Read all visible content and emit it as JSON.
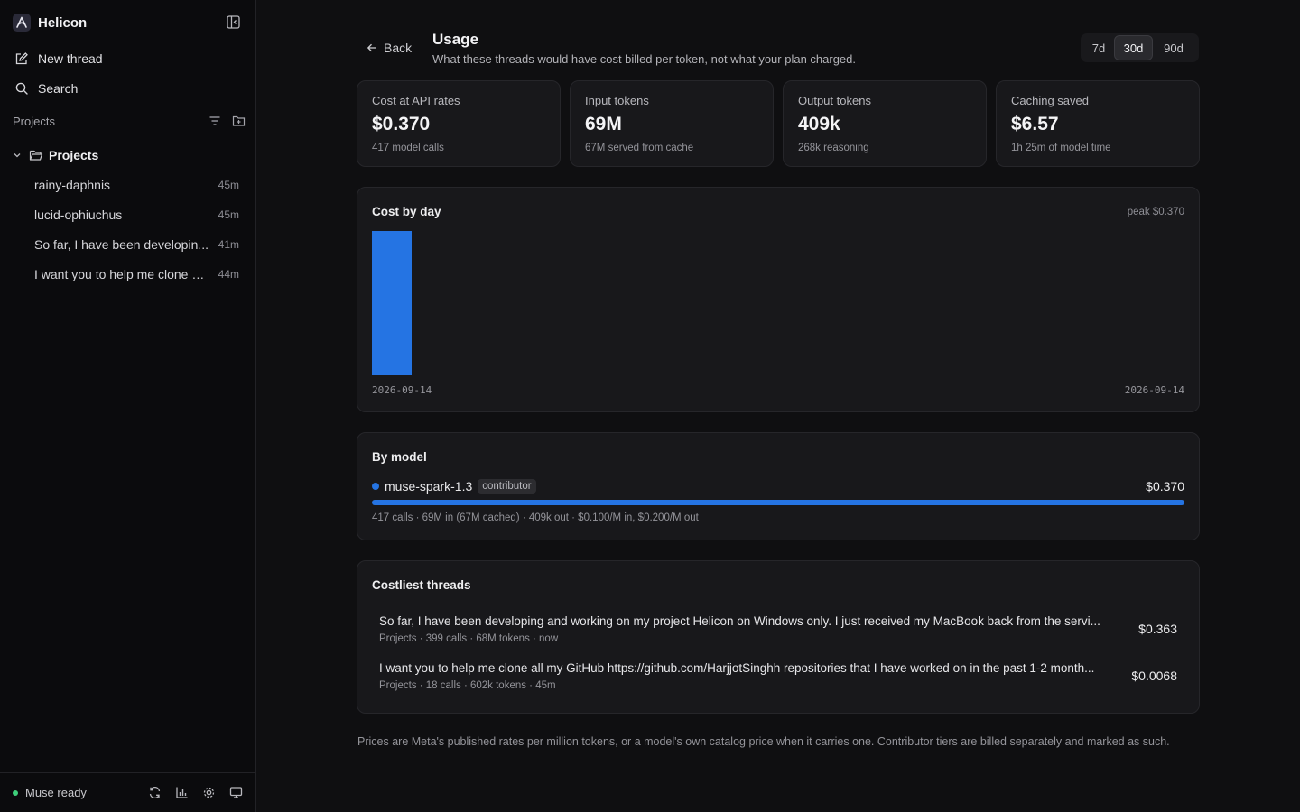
{
  "app": {
    "name": "Helicon"
  },
  "sidebar": {
    "new_thread": "New thread",
    "search": "Search",
    "projects_label": "Projects",
    "folder": {
      "name": "Projects",
      "threads": [
        {
          "title": "rainy-daphnis",
          "age": "45m"
        },
        {
          "title": "lucid-ophiuchus",
          "age": "45m"
        },
        {
          "title": "So far, I have been developin...",
          "age": "41m"
        },
        {
          "title": "I want you to help me clone al...",
          "age": "44m"
        }
      ]
    },
    "footer": {
      "status": "Muse ready",
      "status_color": "#3ecf7a",
      "icons": [
        "refresh-icon",
        "bar-chart-icon",
        "gear-icon",
        "monitor-icon"
      ]
    }
  },
  "header": {
    "back": "Back",
    "title": "Usage",
    "subtitle": "What these threads would have cost billed per token, not what your plan charged.",
    "ranges": [
      "7d",
      "30d",
      "90d"
    ],
    "active_range": "30d"
  },
  "stats": [
    {
      "label": "Cost at API rates",
      "value": "$0.370",
      "sub": "417 model calls"
    },
    {
      "label": "Input tokens",
      "value": "69M",
      "sub": "67M served from cache"
    },
    {
      "label": "Output tokens",
      "value": "409k",
      "sub": "268k reasoning"
    },
    {
      "label": "Caching saved",
      "value": "$6.57",
      "sub": "1h 25m of model time"
    }
  ],
  "cost_by_day": {
    "title": "Cost by day",
    "peak": "peak $0.370",
    "start_label": "2026-09-14",
    "end_label": "2026-09-14"
  },
  "chart_data": {
    "type": "bar",
    "title": "Cost by day",
    "categories": [
      "2026-09-14"
    ],
    "values": [
      0.37
    ],
    "ylim": [
      0,
      0.37
    ],
    "color": "#2574e3",
    "grid": false
  },
  "by_model": {
    "title": "By model",
    "models": [
      {
        "name": "muse-spark-1.3",
        "badge": "contributor",
        "cost": "$0.370",
        "share": 1.0,
        "color": "#2574e3",
        "detail": "417 calls · 69M in (67M cached) · 409k out · $0.100/M in, $0.200/M out"
      }
    ]
  },
  "costliest": {
    "title": "Costliest threads",
    "threads": [
      {
        "title": "So far, I have been developing and working on my project Helicon on Windows only. I just received my MacBook back from the servi...",
        "meta": "Projects · 399 calls · 68M tokens · now",
        "cost": "$0.363"
      },
      {
        "title": "I want you to help me clone all my GitHub https://github.com/HarjjotSinghh repositories that I have worked on in the past 1-2 month...",
        "meta": "Projects · 18 calls · 602k tokens · 45m",
        "cost": "$0.0068"
      }
    ]
  },
  "footnote": "Prices are Meta's published rates per million tokens, or a model's own catalog price when it carries one. Contributor tiers are billed separately and marked as such."
}
